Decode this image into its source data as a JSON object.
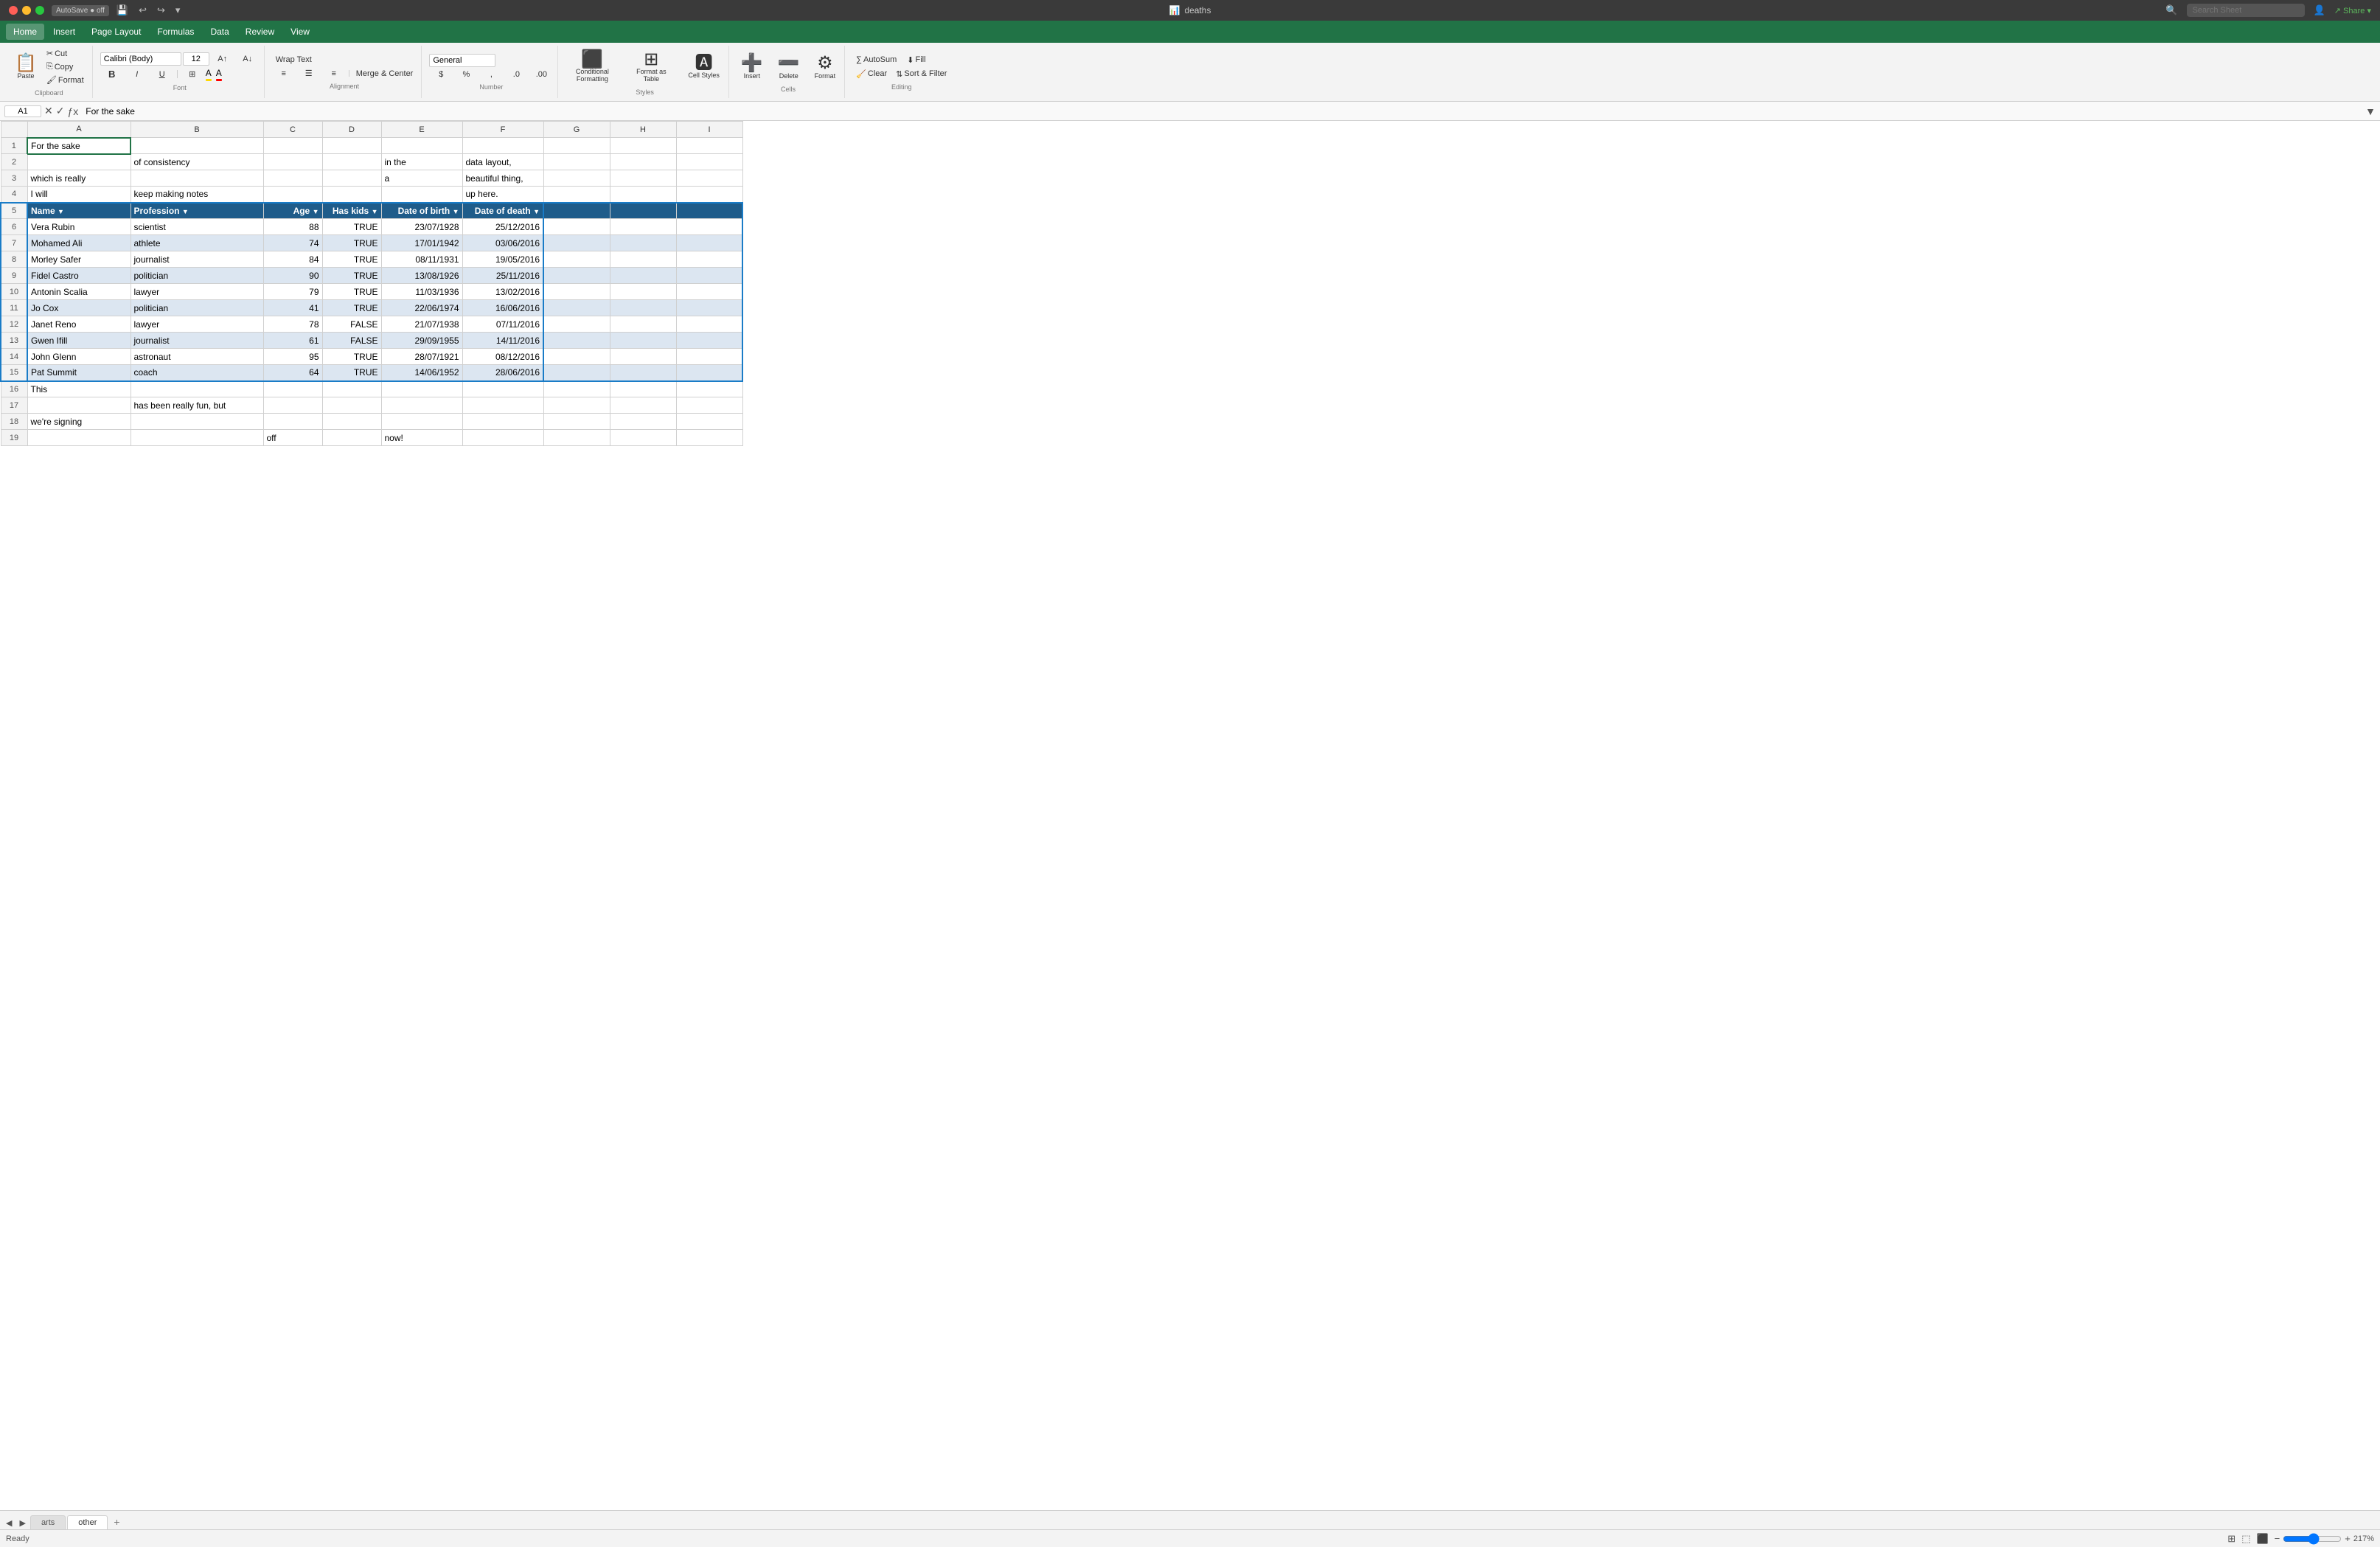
{
  "titleBar": {
    "autosave": "AutoSave ● off",
    "title": "deaths",
    "searchPlaceholder": "Search Sheet"
  },
  "menu": {
    "items": [
      "Home",
      "Insert",
      "Page Layout",
      "Formulas",
      "Data",
      "Review",
      "View"
    ]
  },
  "ribbon": {
    "paste_label": "Paste",
    "cut_label": "Cut",
    "copy_label": "Copy",
    "format_painter_label": "Format",
    "font_name": "Calibri (Body)",
    "font_size": "12",
    "bold": "B",
    "italic": "I",
    "underline": "U",
    "wrap_text": "Wrap Text",
    "merge_center": "Merge & Center",
    "number_format": "General",
    "conditional_formatting": "Conditional Formatting",
    "format_as_table": "Format as Table",
    "cell_styles": "Cell Styles",
    "insert": "Insert",
    "delete": "Delete",
    "format": "Format",
    "autosum": "AutoSum",
    "fill": "Fill",
    "clear": "Clear",
    "sort_filter": "Sort & Filter"
  },
  "formulaBar": {
    "cellRef": "A1",
    "value": "For the sake"
  },
  "columns": [
    "A",
    "B",
    "C",
    "D",
    "E",
    "F",
    "G",
    "H",
    "I"
  ],
  "rows": [
    {
      "id": 1,
      "cells": {
        "A": "For the sake",
        "B": "",
        "C": "",
        "D": "",
        "E": "",
        "F": "",
        "G": "",
        "H": "",
        "I": ""
      }
    },
    {
      "id": 2,
      "cells": {
        "A": "",
        "B": "of consistency",
        "C": "",
        "D": "",
        "E": "in the",
        "F": "data layout,",
        "G": "",
        "H": "",
        "I": ""
      }
    },
    {
      "id": 3,
      "cells": {
        "A": "which is really",
        "B": "",
        "C": "",
        "D": "",
        "E": "a",
        "F": "beautiful thing,",
        "G": "",
        "H": "",
        "I": ""
      }
    },
    {
      "id": 4,
      "cells": {
        "A": "I will",
        "B": "keep making notes",
        "C": "",
        "D": "",
        "E": "",
        "F": "up here.",
        "G": "",
        "H": "",
        "I": ""
      }
    },
    {
      "id": 5,
      "cells": {
        "A": "Name",
        "B": "Profession",
        "C": "Age",
        "D": "Has kids",
        "E": "Date of birth",
        "F": "Date of death",
        "G": "",
        "H": "",
        "I": ""
      },
      "isTableHeader": true
    },
    {
      "id": 6,
      "cells": {
        "A": "Vera Rubin",
        "B": "scientist",
        "C": "88",
        "D": "TRUE",
        "E": "23/07/1928",
        "F": "25/12/2016",
        "G": "",
        "H": "",
        "I": ""
      },
      "isTableRow": true,
      "isOdd": true
    },
    {
      "id": 7,
      "cells": {
        "A": "Mohamed Ali",
        "B": "athlete",
        "C": "74",
        "D": "TRUE",
        "E": "17/01/1942",
        "F": "03/06/2016",
        "G": "",
        "H": "",
        "I": ""
      },
      "isTableRow": true,
      "isOdd": false
    },
    {
      "id": 8,
      "cells": {
        "A": "Morley Safer",
        "B": "journalist",
        "C": "84",
        "D": "TRUE",
        "E": "08/11/1931",
        "F": "19/05/2016",
        "G": "",
        "H": "",
        "I": ""
      },
      "isTableRow": true,
      "isOdd": true
    },
    {
      "id": 9,
      "cells": {
        "A": "Fidel Castro",
        "B": "politician",
        "C": "90",
        "D": "TRUE",
        "E": "13/08/1926",
        "F": "25/11/2016",
        "G": "",
        "H": "",
        "I": ""
      },
      "isTableRow": true,
      "isOdd": false
    },
    {
      "id": 10,
      "cells": {
        "A": "Antonin Scalia",
        "B": "lawyer",
        "C": "79",
        "D": "TRUE",
        "E": "11/03/1936",
        "F": "13/02/2016",
        "G": "",
        "H": "",
        "I": ""
      },
      "isTableRow": true,
      "isOdd": true
    },
    {
      "id": 11,
      "cells": {
        "A": "Jo Cox",
        "B": "politician",
        "C": "41",
        "D": "TRUE",
        "E": "22/06/1974",
        "F": "16/06/2016",
        "G": "",
        "H": "",
        "I": ""
      },
      "isTableRow": true,
      "isOdd": false
    },
    {
      "id": 12,
      "cells": {
        "A": "Janet Reno",
        "B": "lawyer",
        "C": "78",
        "D": "FALSE",
        "E": "21/07/1938",
        "F": "07/11/2016",
        "G": "",
        "H": "",
        "I": ""
      },
      "isTableRow": true,
      "isOdd": true
    },
    {
      "id": 13,
      "cells": {
        "A": "Gwen Ifill",
        "B": "journalist",
        "C": "61",
        "D": "FALSE",
        "E": "29/09/1955",
        "F": "14/11/2016",
        "G": "",
        "H": "",
        "I": ""
      },
      "isTableRow": true,
      "isOdd": false
    },
    {
      "id": 14,
      "cells": {
        "A": "John Glenn",
        "B": "astronaut",
        "C": "95",
        "D": "TRUE",
        "E": "28/07/1921",
        "F": "08/12/2016",
        "G": "",
        "H": "",
        "I": ""
      },
      "isTableRow": true,
      "isOdd": true
    },
    {
      "id": 15,
      "cells": {
        "A": "Pat Summit",
        "B": "coach",
        "C": "64",
        "D": "TRUE",
        "E": "14/06/1952",
        "F": "28/06/2016",
        "G": "",
        "H": "",
        "I": ""
      },
      "isTableRow": true,
      "isOdd": false
    },
    {
      "id": 16,
      "cells": {
        "A": "This",
        "B": "",
        "C": "",
        "D": "",
        "E": "",
        "F": "",
        "G": "",
        "H": "",
        "I": ""
      }
    },
    {
      "id": 17,
      "cells": {
        "A": "",
        "B": "has been really fun, but",
        "C": "",
        "D": "",
        "E": "",
        "F": "",
        "G": "",
        "H": "",
        "I": ""
      }
    },
    {
      "id": 18,
      "cells": {
        "A": "we're signing",
        "B": "",
        "C": "",
        "D": "",
        "E": "",
        "F": "",
        "G": "",
        "H": "",
        "I": ""
      }
    },
    {
      "id": 19,
      "cells": {
        "A": "",
        "B": "",
        "C": "off",
        "D": "",
        "E": "now!",
        "F": "",
        "G": "",
        "H": "",
        "I": ""
      }
    }
  ],
  "sheets": [
    {
      "name": "arts",
      "active": false
    },
    {
      "name": "other",
      "active": true
    }
  ],
  "status": {
    "ready": "Ready",
    "zoom": "217%"
  }
}
